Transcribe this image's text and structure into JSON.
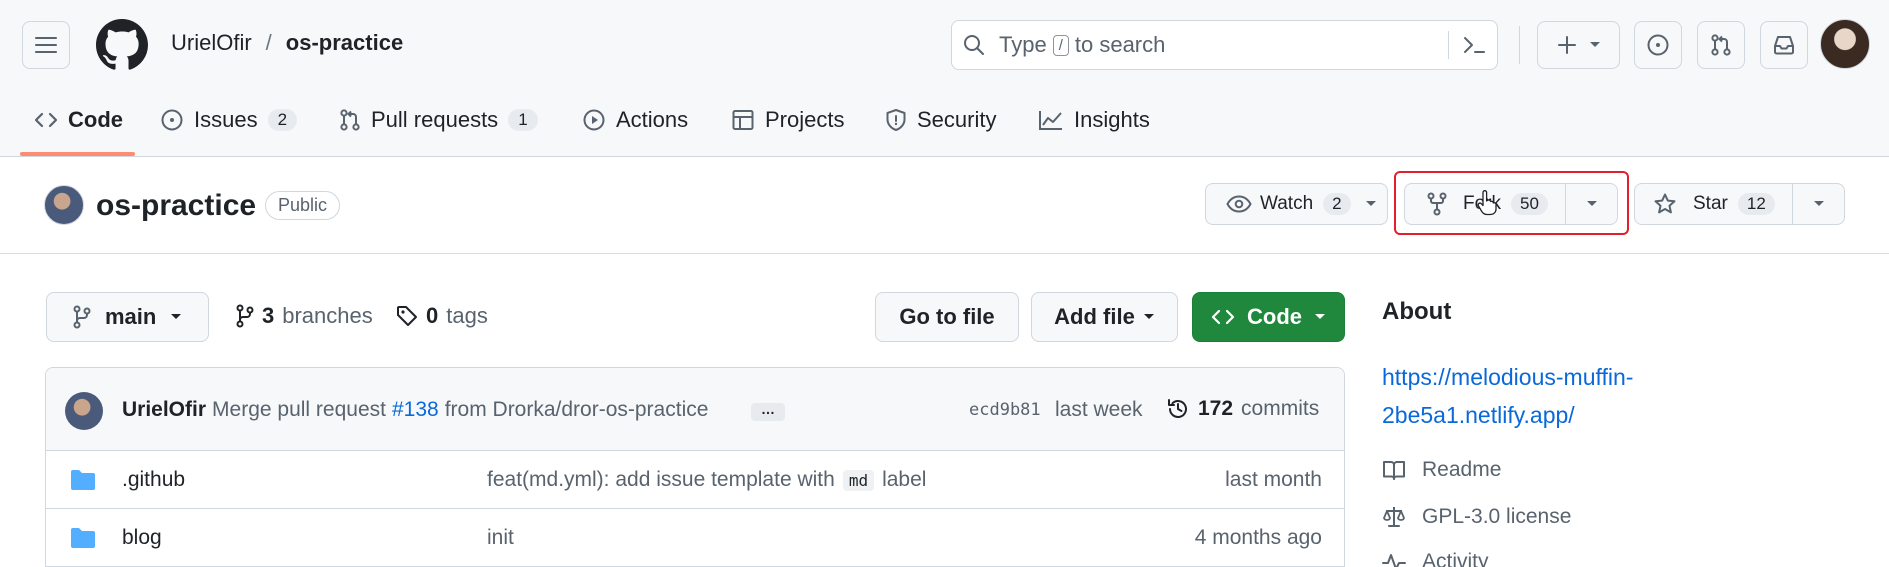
{
  "header": {
    "owner": "UrielOfir",
    "separator": "/",
    "repo": "os-practice",
    "search": {
      "before": "Type",
      "key": "/",
      "after": "to search"
    }
  },
  "tabs": [
    {
      "label": "Code"
    },
    {
      "label": "Issues",
      "count": "2"
    },
    {
      "label": "Pull requests",
      "count": "1"
    },
    {
      "label": "Actions"
    },
    {
      "label": "Projects"
    },
    {
      "label": "Security"
    },
    {
      "label": "Insights"
    }
  ],
  "repo_head": {
    "name": "os-practice",
    "visibility": "Public",
    "watch": {
      "label": "Watch",
      "count": "2"
    },
    "fork": {
      "label": "Fork",
      "count": "50"
    },
    "star": {
      "label": "Star",
      "count": "12"
    }
  },
  "file_nav": {
    "branch": "main",
    "branches_count": "3",
    "branches_label": "branches",
    "tags_count": "0",
    "tags_label": "tags",
    "goto_label": "Go to file",
    "addfile_label": "Add file",
    "code_label": "Code"
  },
  "commit": {
    "author": "UrielOfir",
    "message_before": "Merge pull request",
    "pr": "#138",
    "message_after": "from Drorka/dror-os-practice",
    "more": "…",
    "sha": "ecd9b81",
    "time": "last week",
    "count": "172",
    "count_label": "commits"
  },
  "files": [
    {
      "name": ".github",
      "msg_before": "feat(md.yml): add issue template with",
      "msg_code": "md",
      "msg_after": "label",
      "time": "last month"
    },
    {
      "name": "blog",
      "msg_before": "init",
      "msg_code": "",
      "msg_after": "",
      "time": "4 months ago"
    }
  ],
  "sidebar": {
    "about": "About",
    "link": "https://melodious-muffin-2be5a1.netlify.app/",
    "readme": "Readme",
    "license": "GPL-3.0 license",
    "activity": "Activity"
  },
  "colors": {
    "accent_green": "#1f883d",
    "link_blue": "#0969da",
    "tab_underline": "#fd8c73",
    "highlight_red": "#e0202a",
    "folder_blue": "#54aeff"
  }
}
